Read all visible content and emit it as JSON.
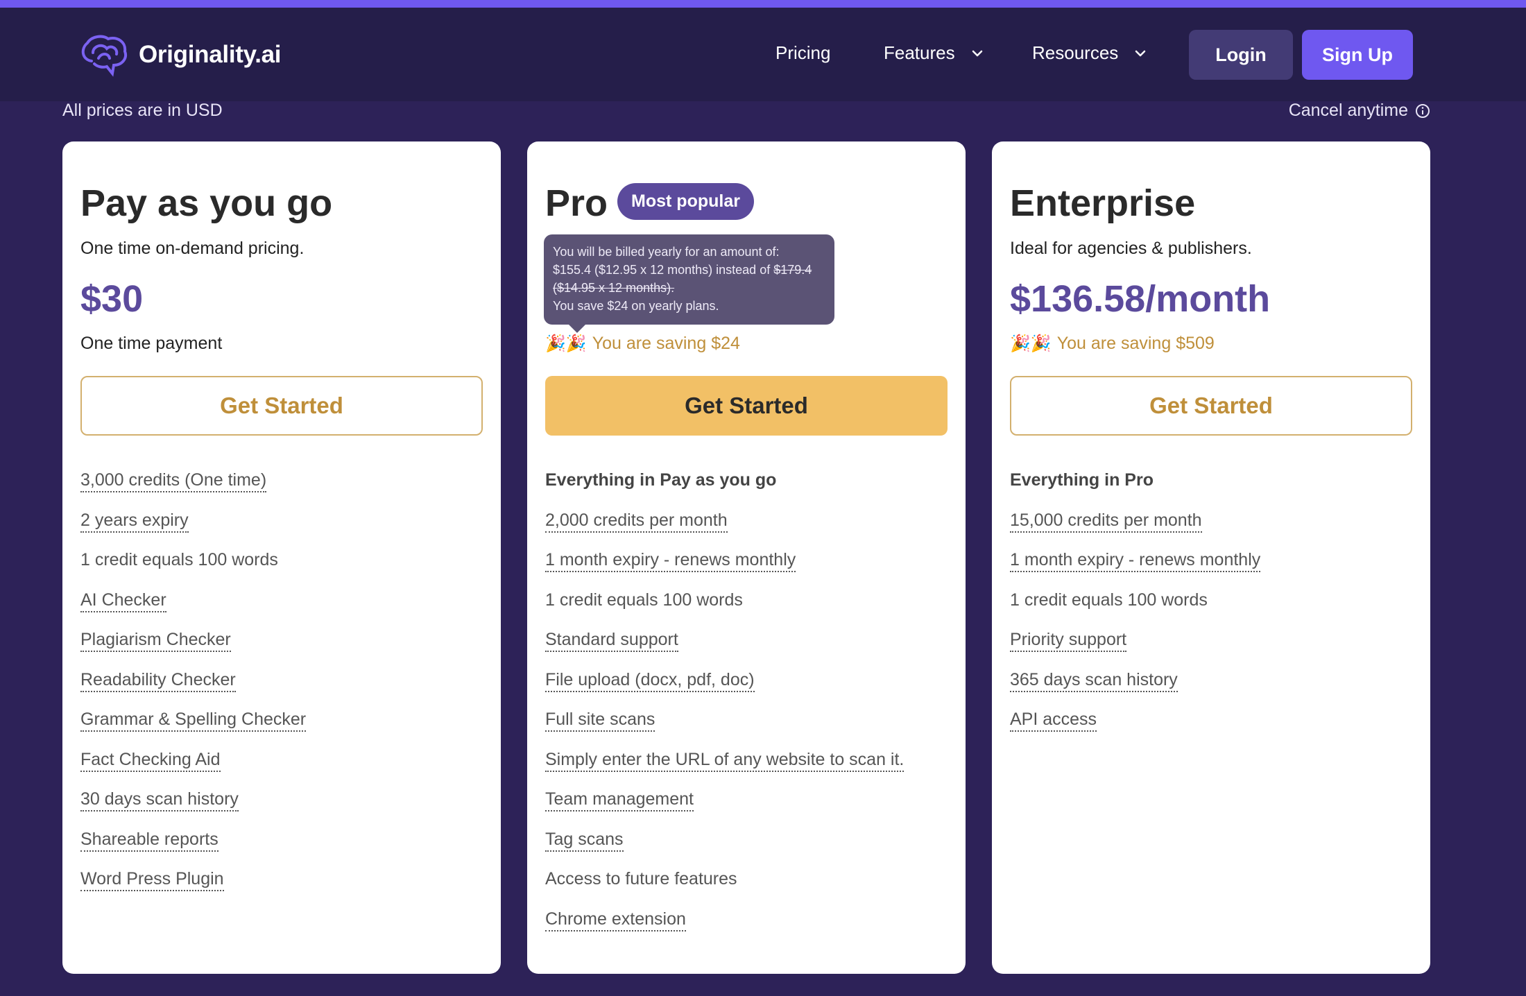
{
  "brand": {
    "name": "Originality.ai"
  },
  "nav": {
    "pricing": "Pricing",
    "features": "Features",
    "resources": "Resources",
    "login": "Login",
    "signup": "Sign Up"
  },
  "subheader": {
    "prices_note": "All prices are in USD",
    "cancel_note": "Cancel anytime"
  },
  "plans": [
    {
      "title": "Pay as you go",
      "subtitle": "One time on-demand pricing.",
      "price": "$30",
      "price_note": "One time payment",
      "cta": "Get Started",
      "features": [
        {
          "text": "3,000 credits (One time)",
          "dotted": true
        },
        {
          "text": "2 years expiry",
          "dotted": true
        },
        {
          "text": "1 credit equals 100 words",
          "dotted": false
        },
        {
          "text": "AI Checker",
          "dotted": true
        },
        {
          "text": "Plagiarism Checker",
          "dotted": true
        },
        {
          "text": "Readability Checker",
          "dotted": true
        },
        {
          "text": "Grammar & Spelling Checker",
          "dotted": true
        },
        {
          "text": "Fact Checking Aid",
          "dotted": true
        },
        {
          "text": "30 days scan history",
          "dotted": true
        },
        {
          "text": "Shareable reports",
          "dotted": true
        },
        {
          "text": "Word Press Plugin",
          "dotted": true
        }
      ]
    },
    {
      "title": "Pro",
      "badge": "Most popular",
      "saving": "You are saving $24",
      "cta": "Get Started",
      "tooltip": {
        "line1": "You will be billed yearly for an amount of:",
        "line2_a": "$155.4 ($12.95 x 12 months) instead of ",
        "line2_strike": "$179.4",
        "line3_strike": "($14.95 x 12 months).",
        "line4": "You save $24 on yearly plans."
      },
      "features_head": "Everything in Pay as you go",
      "features": [
        {
          "text": "2,000 credits per month",
          "dotted": true
        },
        {
          "text": "1 month expiry - renews monthly",
          "dotted": true
        },
        {
          "text": "1 credit equals 100 words",
          "dotted": false
        },
        {
          "text": "Standard support",
          "dotted": true
        },
        {
          "text": "File upload (docx, pdf, doc)",
          "dotted": true
        },
        {
          "text": "Full site scans",
          "dotted": true
        },
        {
          "text": "Simply enter the URL of any website to scan it.",
          "dotted": true
        },
        {
          "text": "Team management",
          "dotted": true
        },
        {
          "text": "Tag scans",
          "dotted": true
        },
        {
          "text": "Access to future features",
          "dotted": false
        },
        {
          "text": "Chrome extension",
          "dotted": true
        }
      ]
    },
    {
      "title": "Enterprise",
      "subtitle": "Ideal for agencies & publishers.",
      "price": "$136.58/month",
      "saving": "You are saving $509",
      "cta": "Get Started",
      "features_head": "Everything in Pro",
      "features": [
        {
          "text": "15,000 credits per month",
          "dotted": true
        },
        {
          "text": "1 month expiry - renews monthly",
          "dotted": true
        },
        {
          "text": "1 credit equals 100 words",
          "dotted": false
        },
        {
          "text": "Priority support",
          "dotted": true
        },
        {
          "text": "365 days scan history",
          "dotted": true
        },
        {
          "text": "API access",
          "dotted": true
        }
      ]
    }
  ],
  "icons": {
    "logo": "brain-logo-icon",
    "chevron": "chevron-down-icon",
    "info": "info-circle-icon",
    "party": "party-popper-icon"
  },
  "colors": {
    "accent": "#6f58f0",
    "navbar": "#251e4a",
    "background": "#2d2258",
    "price": "#5b4a9c",
    "gold": "#bf8f3a",
    "cta_fill": "#f2c066"
  }
}
